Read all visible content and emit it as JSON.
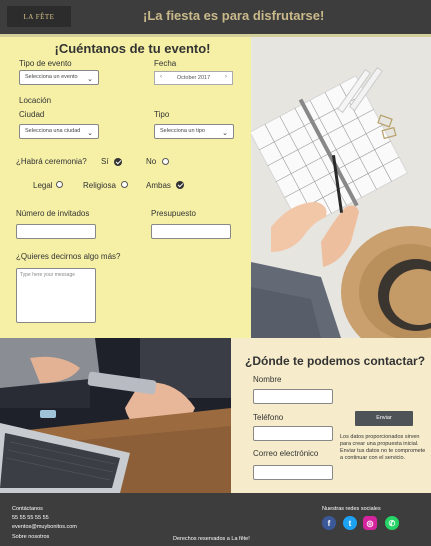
{
  "header": {
    "logo_text": "LA FÊTE",
    "tagline": "¡La fiesta es para disfrutarse!"
  },
  "event_form": {
    "title": "¡Cuéntanos de tu evento!",
    "event_type": {
      "label": "Tipo de evento",
      "value": "Selecciona un evento"
    },
    "date": {
      "label": "Fecha",
      "value": "October 2017"
    },
    "location_label": "Locación",
    "city": {
      "label": "Ciudad",
      "value": "Selecciona una ciudad"
    },
    "type": {
      "label": "Tipo",
      "value": "Selecciona un tipo"
    },
    "ceremony": {
      "question": "¿Habrá ceremonia?",
      "yes": "Sí",
      "no": "No",
      "selected": "Sí"
    },
    "ceremony_kind": {
      "legal": "Legal",
      "religious": "Religiosa",
      "both": "Ambas",
      "selected": "Ambas"
    },
    "guests_label": "Número de invitados",
    "budget_label": "Presupuesto",
    "more_label": "¿Quieres decirnos algo más?",
    "message_placeholder": "Type here your message"
  },
  "contact_form": {
    "title": "¿Dónde te podemos contactar?",
    "name_label": "Nombre",
    "phone_label": "Teléfono",
    "email_label": "Correo electrónico",
    "send_label": "Enviar",
    "note": "Los datos proporcionados sirven para crear una propuesta inicial. Enviar tus datos no te compromete a continuar con el servicio."
  },
  "footer": {
    "contact_heading": "Contáctanos",
    "phone": "55 55 55 55 55",
    "email": "eventos@muybonitos.com",
    "about": "Sobre nosotros",
    "copyright": "Derechos reservados a La fête!",
    "social_heading": "Nuestras redes sociales",
    "social": [
      {
        "name": "facebook-icon",
        "glyph": "f",
        "color": "#3b5998"
      },
      {
        "name": "twitter-icon",
        "glyph": "t",
        "color": "#1da1f2"
      },
      {
        "name": "instagram-icon",
        "glyph": "◎",
        "color": "#d6249f"
      },
      {
        "name": "whatsapp-icon",
        "glyph": "✆",
        "color": "#25d366"
      }
    ]
  },
  "colors": {
    "header_bg": "#3d3d3d",
    "tagline": "#c9b98a",
    "event_bg": "#f5f0a6",
    "contact_bg": "#f6eccb",
    "button_bg": "#4e5358"
  }
}
